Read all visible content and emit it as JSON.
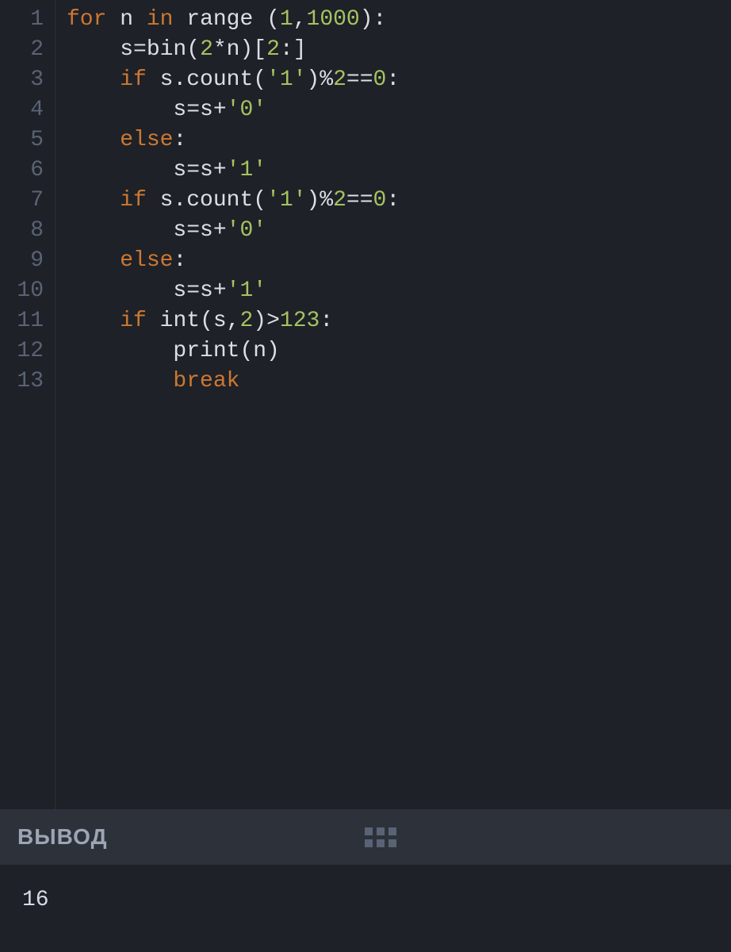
{
  "editor": {
    "line_numbers": [
      "1",
      "2",
      "3",
      "4",
      "5",
      "6",
      "7",
      "8",
      "9",
      "10",
      "11",
      "12",
      "13"
    ],
    "lines": [
      [
        {
          "t": "for",
          "c": "c-orange"
        },
        {
          "t": " n ",
          "c": "c-white"
        },
        {
          "t": "in",
          "c": "c-orange"
        },
        {
          "t": " ",
          "c": "c-white"
        },
        {
          "t": "range",
          "c": "c-white"
        },
        {
          "t": " (",
          "c": "c-white"
        },
        {
          "t": "1",
          "c": "c-green"
        },
        {
          "t": ",",
          "c": "c-white"
        },
        {
          "t": "1000",
          "c": "c-green"
        },
        {
          "t": "):",
          "c": "c-white"
        }
      ],
      [
        {
          "t": "    s=",
          "c": "c-white"
        },
        {
          "t": "bin",
          "c": "c-white"
        },
        {
          "t": "(",
          "c": "c-white"
        },
        {
          "t": "2",
          "c": "c-green"
        },
        {
          "t": "*n)[",
          "c": "c-white"
        },
        {
          "t": "2",
          "c": "c-green"
        },
        {
          "t": ":]",
          "c": "c-white"
        }
      ],
      [
        {
          "t": "    ",
          "c": "c-white"
        },
        {
          "t": "if",
          "c": "c-orange"
        },
        {
          "t": " s.",
          "c": "c-white"
        },
        {
          "t": "count",
          "c": "c-white"
        },
        {
          "t": "(",
          "c": "c-white"
        },
        {
          "t": "'1'",
          "c": "c-green2"
        },
        {
          "t": ")%",
          "c": "c-white"
        },
        {
          "t": "2",
          "c": "c-green"
        },
        {
          "t": "==",
          "c": "c-white"
        },
        {
          "t": "0",
          "c": "c-green"
        },
        {
          "t": ":",
          "c": "c-white"
        }
      ],
      [
        {
          "t": "        s=s+",
          "c": "c-white"
        },
        {
          "t": "'0'",
          "c": "c-green2"
        }
      ],
      [
        {
          "t": "    ",
          "c": "c-white"
        },
        {
          "t": "else",
          "c": "c-orange"
        },
        {
          "t": ":",
          "c": "c-white"
        }
      ],
      [
        {
          "t": "        s=s+",
          "c": "c-white"
        },
        {
          "t": "'1'",
          "c": "c-green2"
        }
      ],
      [
        {
          "t": "    ",
          "c": "c-white"
        },
        {
          "t": "if",
          "c": "c-orange"
        },
        {
          "t": " s.",
          "c": "c-white"
        },
        {
          "t": "count",
          "c": "c-white"
        },
        {
          "t": "(",
          "c": "c-white"
        },
        {
          "t": "'1'",
          "c": "c-green2"
        },
        {
          "t": ")%",
          "c": "c-white"
        },
        {
          "t": "2",
          "c": "c-green"
        },
        {
          "t": "==",
          "c": "c-white"
        },
        {
          "t": "0",
          "c": "c-green"
        },
        {
          "t": ":",
          "c": "c-white"
        }
      ],
      [
        {
          "t": "        s=s+",
          "c": "c-white"
        },
        {
          "t": "'0'",
          "c": "c-green2"
        }
      ],
      [
        {
          "t": "    ",
          "c": "c-white"
        },
        {
          "t": "else",
          "c": "c-orange"
        },
        {
          "t": ":",
          "c": "c-white"
        }
      ],
      [
        {
          "t": "        s=s+",
          "c": "c-white"
        },
        {
          "t": "'1'",
          "c": "c-green2"
        }
      ],
      [
        {
          "t": "    ",
          "c": "c-white"
        },
        {
          "t": "if",
          "c": "c-orange"
        },
        {
          "t": " ",
          "c": "c-white"
        },
        {
          "t": "int",
          "c": "c-white"
        },
        {
          "t": "(s,",
          "c": "c-white"
        },
        {
          "t": "2",
          "c": "c-green"
        },
        {
          "t": ")>",
          "c": "c-white"
        },
        {
          "t": "123",
          "c": "c-green"
        },
        {
          "t": ":",
          "c": "c-white"
        }
      ],
      [
        {
          "t": "        ",
          "c": "c-white"
        },
        {
          "t": "print",
          "c": "c-white"
        },
        {
          "t": "(n)",
          "c": "c-white"
        }
      ],
      [
        {
          "t": "        ",
          "c": "c-white"
        },
        {
          "t": "break",
          "c": "c-orange"
        }
      ]
    ]
  },
  "output": {
    "title": "ВЫВОД",
    "text": "16"
  }
}
